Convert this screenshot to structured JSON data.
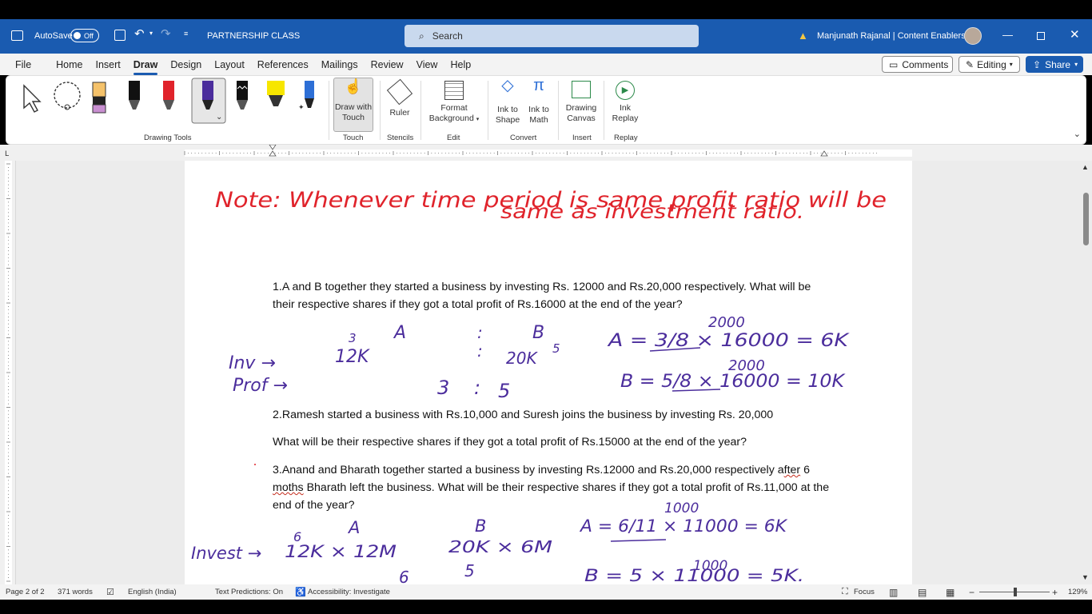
{
  "titlebar": {
    "autosave_label": "AutoSave",
    "autosave_state": "Off",
    "doc_title": "PARTNERSHIP CLASS",
    "search_placeholder": "Search",
    "user_name": "Manjunath Rajanal | Content Enablers"
  },
  "menu": {
    "items": [
      "File",
      "Home",
      "Insert",
      "Draw",
      "Design",
      "Layout",
      "References",
      "Mailings",
      "Review",
      "View",
      "Help"
    ],
    "active": "Draw",
    "comments_label": "Comments",
    "editing_label": "Editing",
    "share_label": "Share"
  },
  "ribbon": {
    "groups": {
      "drawing_tools": "Drawing Tools",
      "touch": "Touch",
      "stencils": "Stencils",
      "edit": "Edit",
      "convert": "Convert",
      "insert": "Insert",
      "replay": "Replay"
    },
    "tools": {
      "draw_with_touch": "Draw with Touch",
      "ruler": "Ruler",
      "format_background": "Format Background",
      "ink_to_shape": "Ink to Shape",
      "ink_to_math": "Ink to Math",
      "drawing_canvas": "Drawing Canvas",
      "ink_replay": "Ink Replay"
    }
  },
  "document": {
    "handwritten_note_line1": "Note: Whenever time period is same profit ratio will be",
    "handwritten_note_line2": "same as investment ratio.",
    "q1": "1.A and B together they started a business by investing Rs. 12000 and Rs.20,000 respectively. What will be their respective shares if they got a total profit of Rs.16000 at the end of the year?",
    "q2_line1": "2.Ramesh started a business with Rs.10,000 and Suresh joins the business by investing Rs. 20,000",
    "q2_line2": "What will be their respective shares if they got a total profit of Rs.15000 at the end of the year?",
    "q3_part1": "3.Anand and Bharath together started a business by investing Rs.12000 and Rs.20,000 respectively a",
    "q3_squiggle1": "fter",
    "q3_squiggle2": "moths",
    "q3_part2": " Bharath left the business. What will be their respective shares if they got a total profit of Rs.11,000 at the end of the year?",
    "ink": {
      "inv": "Inv →",
      "prof": "Prof →",
      "a_label": "A",
      "b_label": "B",
      "a_inv": "12K",
      "a_inv_reduced": "3",
      "b_inv": "20K",
      "b_inv_reduced": "5",
      "ratio_a": "3",
      "ratio_colon": ":",
      "ratio_b": "5",
      "a_calc": "A = 3/8 × 16000 = 6K",
      "a_calc_top": "2000",
      "b_calc": "B = 5/8 × 16000 = 10K",
      "b_calc_top": "2000",
      "invest": "Invest →",
      "q3_a": "A",
      "q3_b": "B",
      "q3_a_inv": "12K × 12M",
      "q3_a_inv_top": "6",
      "q3_b_inv": "20K × 6M",
      "q3_ratio_a": "6",
      "q3_ratio_b": "5",
      "q3_a_calc": "A = 6/11 × 11000 = 6K",
      "q3_a_calc_top": "1000",
      "q3_b_calc": "B = 5 × 11000 = 5K.",
      "q3_b_calc_top": "1000"
    }
  },
  "status": {
    "page": "Page 2 of 2",
    "words": "371 words",
    "language": "English (India)",
    "predictions": "Text Predictions: On",
    "accessibility": "Accessibility: Investigate",
    "focus": "Focus",
    "zoom": "129%"
  },
  "colors": {
    "title_blue": "#1a5bb0",
    "ink_red": "#e0232b",
    "ink_purple": "#4b2d9c"
  }
}
